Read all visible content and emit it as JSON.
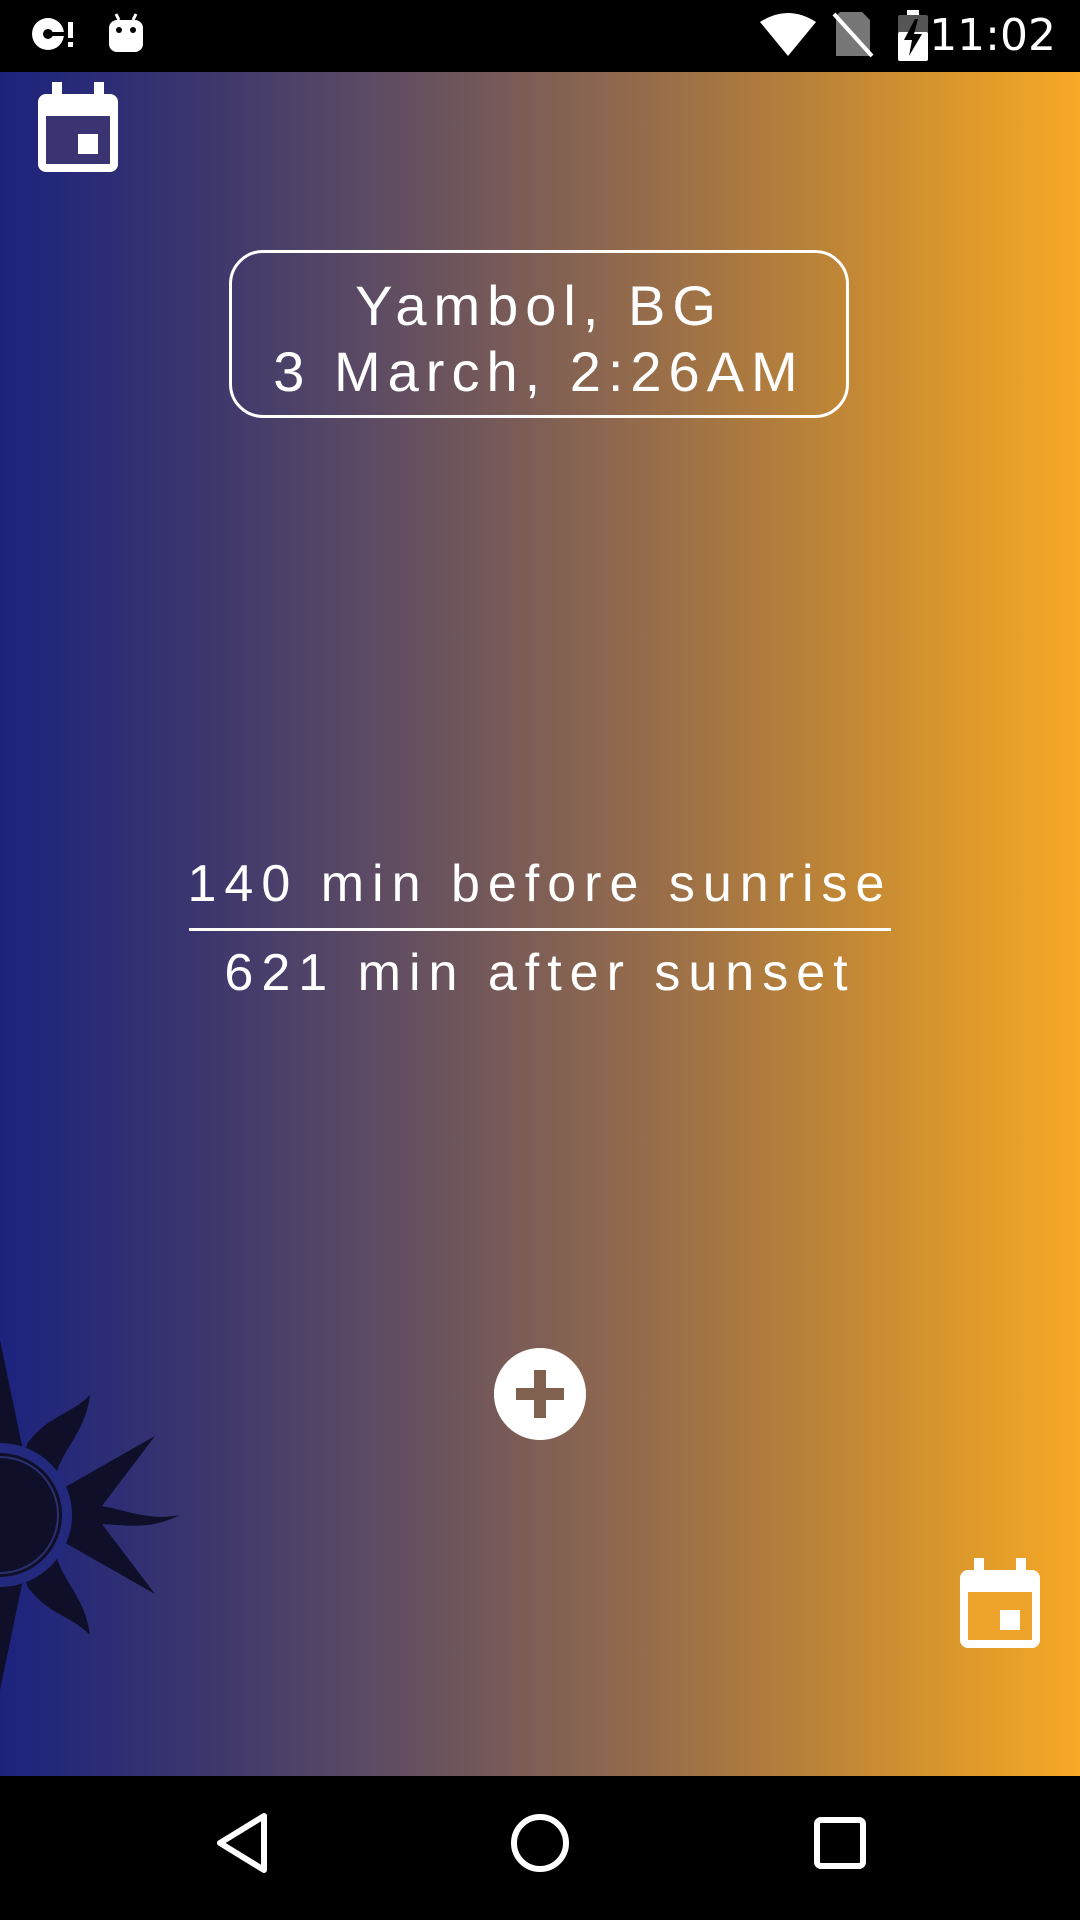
{
  "status_bar": {
    "time": "11:02",
    "icons": [
      "media-notification-icon",
      "android-notification-icon",
      "wifi-icon",
      "no-sim-icon",
      "battery-charging-icon"
    ]
  },
  "main": {
    "location": "Yambol, BG",
    "datetime": "3 March, 2:26AM",
    "before_sunrise": "140 min before sunrise",
    "after_sunset": "621 min after sunset",
    "gradient_colors": [
      "#1c237e",
      "#8a6550",
      "#f7a928"
    ],
    "sun_color": "#0f0f2a"
  },
  "nav_bar": {
    "buttons": [
      "back-icon",
      "home-icon",
      "recents-icon"
    ]
  }
}
